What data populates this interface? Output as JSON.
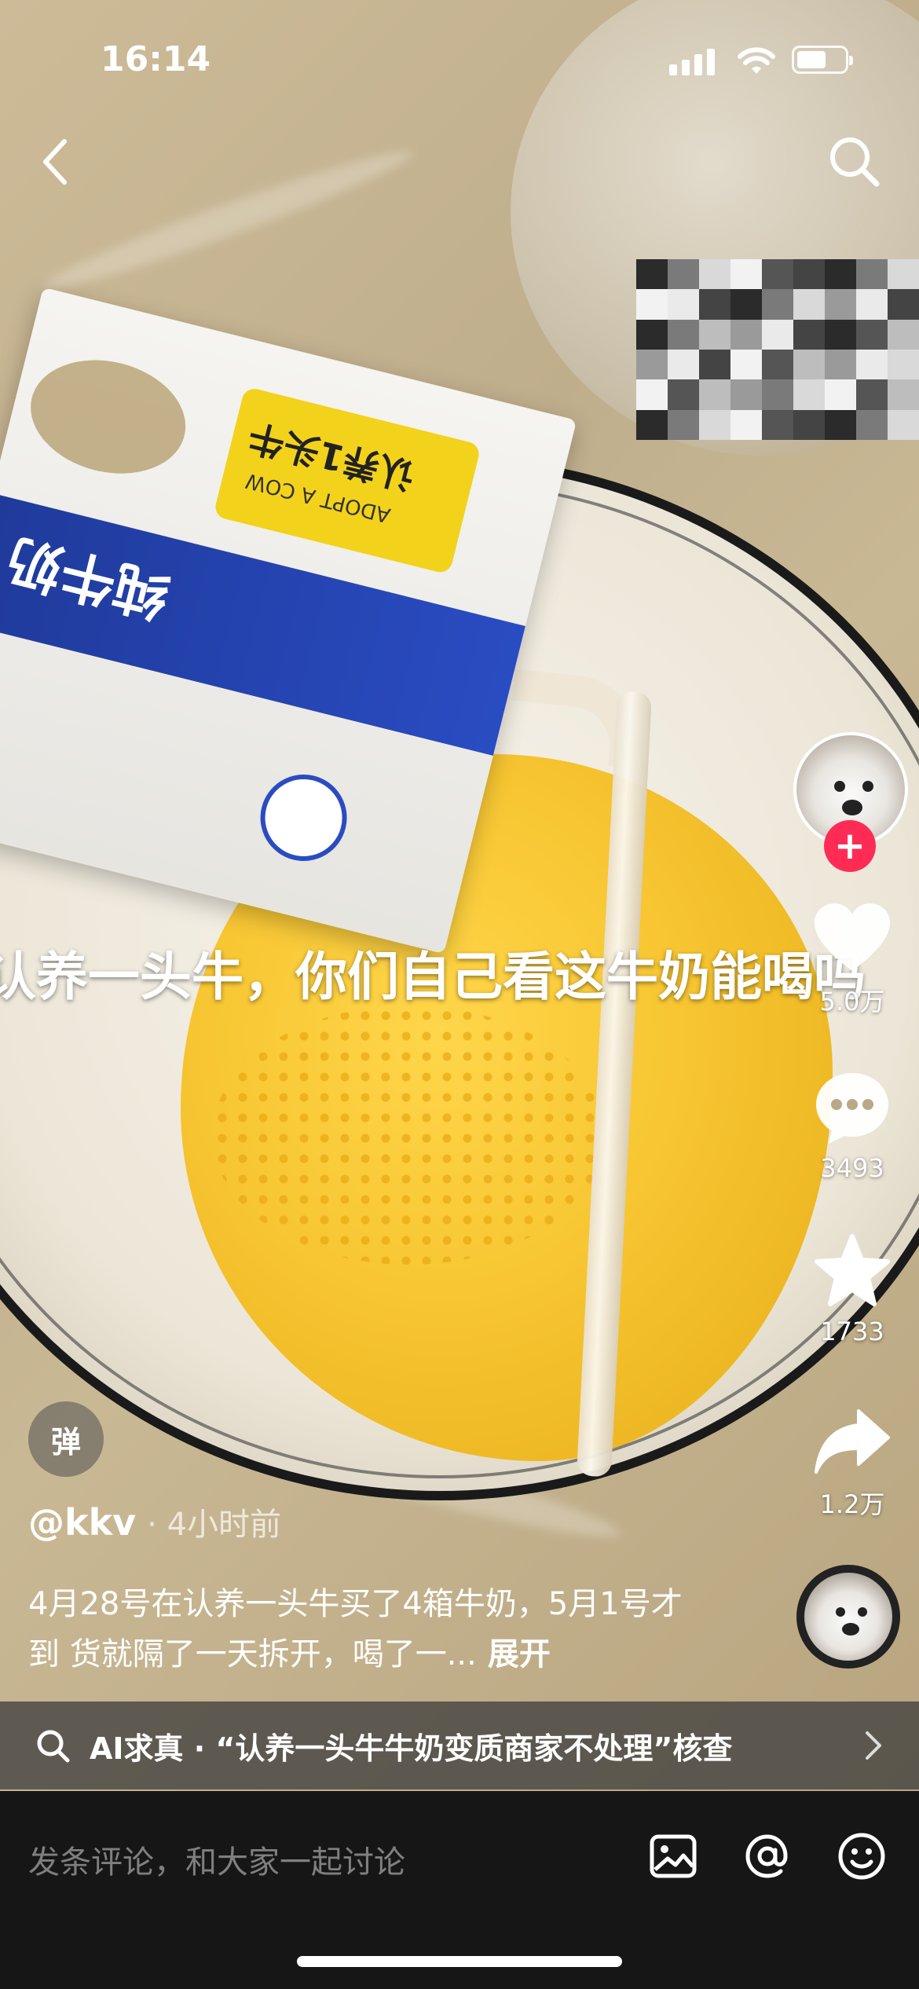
{
  "status_bar": {
    "time": "16:14",
    "icons": [
      "signal-icon",
      "wifi-icon",
      "battery-icon"
    ]
  },
  "nav": {
    "back_icon": "chevron-left-icon",
    "search_icon": "search-icon"
  },
  "video": {
    "overlay_caption": "认养一头牛，你们自己看这牛奶能喝吗",
    "carton_brand": "认养1头牛",
    "carton_brand_en": "ADOPT A COW",
    "carton_product": "纯牛奶"
  },
  "actions": {
    "like_count": "5.0万",
    "comment_count": "3493",
    "favorite_count": "1733",
    "share_count": "1.2万",
    "follow_symbol": "+"
  },
  "post": {
    "danmaku_label": "弹",
    "author": "@kkv",
    "time": "· 4小时前",
    "description": "4月28号在认养一头牛买了4箱牛奶，5月1号才到 货就隔了一天拆开，喝了一...",
    "expand": "展开"
  },
  "fact_check": {
    "text": "AI求真 · “认养一头牛牛奶变质商家不处理”核查"
  },
  "comment_bar": {
    "placeholder": "发条评论，和大家一起讨论"
  },
  "colors": {
    "follow_red": "#fe2c55",
    "bar_dark": "#161616"
  }
}
